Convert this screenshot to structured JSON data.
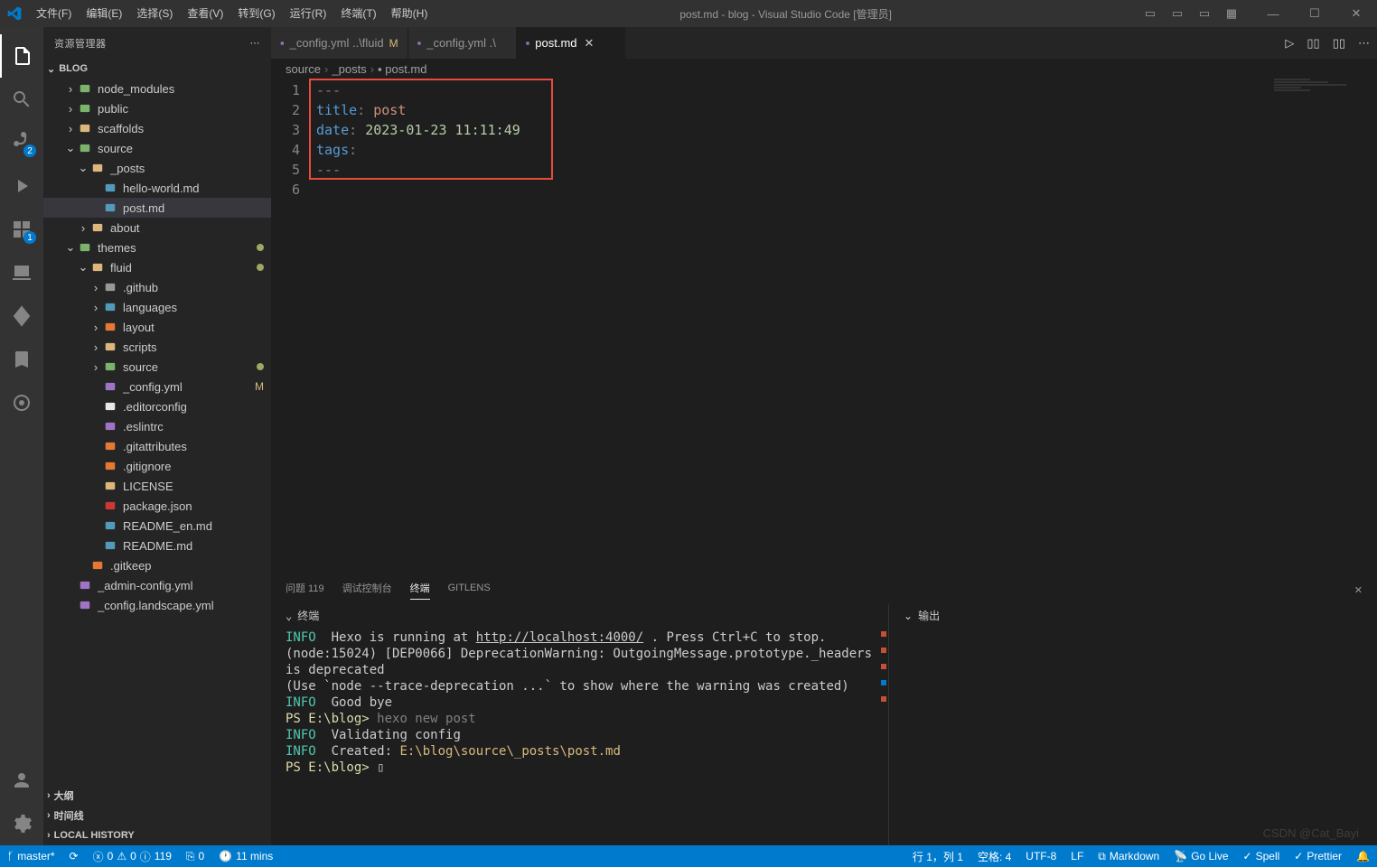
{
  "titlebar": {
    "menus": [
      "文件(F)",
      "编辑(E)",
      "选择(S)",
      "查看(V)",
      "转到(G)",
      "运行(R)",
      "终端(T)",
      "帮助(H)"
    ],
    "title": "post.md - blog - Visual Studio Code [管理员]"
  },
  "sidebar": {
    "title": "资源管理器",
    "section": "BLOG",
    "bottom_sections": [
      "大纲",
      "时间线",
      "LOCAL HISTORY"
    ]
  },
  "tree": [
    {
      "indent": 1,
      "chev": ">",
      "icon": "folder-node",
      "label": "node_modules",
      "color": "#7cb36a"
    },
    {
      "indent": 1,
      "chev": ">",
      "icon": "folder-public",
      "label": "public",
      "color": "#7cb36a"
    },
    {
      "indent": 1,
      "chev": ">",
      "icon": "folder",
      "label": "scaffolds",
      "color": "#dcb67a"
    },
    {
      "indent": 1,
      "chev": "v",
      "icon": "folder-src",
      "label": "source",
      "color": "#7cb36a"
    },
    {
      "indent": 2,
      "chev": "v",
      "icon": "folder-open",
      "label": "_posts",
      "color": "#dcb67a"
    },
    {
      "indent": 3,
      "chev": "",
      "icon": "md",
      "label": "hello-world.md",
      "color": "#519aba"
    },
    {
      "indent": 3,
      "chev": "",
      "icon": "md",
      "label": "post.md",
      "color": "#519aba",
      "selected": true
    },
    {
      "indent": 2,
      "chev": ">",
      "icon": "folder",
      "label": "about",
      "color": "#dcb67a"
    },
    {
      "indent": 1,
      "chev": "v",
      "icon": "folder-theme",
      "label": "themes",
      "color": "#7cb36a",
      "dot": true
    },
    {
      "indent": 2,
      "chev": "v",
      "icon": "folder-open",
      "label": "fluid",
      "color": "#dcb67a",
      "dot": true
    },
    {
      "indent": 3,
      "chev": ">",
      "icon": "folder-git",
      "label": ".github",
      "color": "#999"
    },
    {
      "indent": 3,
      "chev": ">",
      "icon": "folder-lang",
      "label": "languages",
      "color": "#519aba"
    },
    {
      "indent": 3,
      "chev": ">",
      "icon": "folder-layout",
      "label": "layout",
      "color": "#e37933"
    },
    {
      "indent": 3,
      "chev": ">",
      "icon": "folder-script",
      "label": "scripts",
      "color": "#dcb67a"
    },
    {
      "indent": 3,
      "chev": ">",
      "icon": "folder-src",
      "label": "source",
      "color": "#7cb36a",
      "dot": true
    },
    {
      "indent": 3,
      "chev": "",
      "icon": "yml",
      "label": "_config.yml",
      "color": "#a074c4",
      "status": "M"
    },
    {
      "indent": 3,
      "chev": "",
      "icon": "editorconfig",
      "label": ".editorconfig",
      "color": "#e8e8e8"
    },
    {
      "indent": 3,
      "chev": "",
      "icon": "eslint",
      "label": ".eslintrc",
      "color": "#a074c4"
    },
    {
      "indent": 3,
      "chev": "",
      "icon": "git",
      "label": ".gitattributes",
      "color": "#e37933"
    },
    {
      "indent": 3,
      "chev": "",
      "icon": "git",
      "label": ".gitignore",
      "color": "#e37933"
    },
    {
      "indent": 3,
      "chev": "",
      "icon": "license",
      "label": "LICENSE",
      "color": "#dcb67a"
    },
    {
      "indent": 3,
      "chev": "",
      "icon": "npm",
      "label": "package.json",
      "color": "#cb3837"
    },
    {
      "indent": 3,
      "chev": "",
      "icon": "md",
      "label": "README_en.md",
      "color": "#519aba"
    },
    {
      "indent": 3,
      "chev": "",
      "icon": "md",
      "label": "README.md",
      "color": "#519aba"
    },
    {
      "indent": 2,
      "chev": "",
      "icon": "git",
      "label": ".gitkeep",
      "color": "#e37933"
    },
    {
      "indent": 1,
      "chev": "",
      "icon": "yml",
      "label": "_admin-config.yml",
      "color": "#a074c4"
    },
    {
      "indent": 1,
      "chev": "",
      "icon": "yml",
      "label": "_config.landscape.yml",
      "color": "#a074c4"
    }
  ],
  "tabs": [
    {
      "icon": "yml",
      "label": "_config.yml ..\\fluid",
      "status": "M",
      "active": false
    },
    {
      "icon": "yml",
      "label": "_config.yml .\\",
      "status": "",
      "active": false
    },
    {
      "icon": "md",
      "label": "post.md",
      "status": "",
      "active": true
    }
  ],
  "breadcrumb": [
    "source",
    "_posts",
    "post.md"
  ],
  "editor": {
    "lines": [
      {
        "n": 1,
        "tokens": [
          {
            "c": "fm",
            "t": "---"
          }
        ]
      },
      {
        "n": 2,
        "tokens": [
          {
            "c": "key",
            "t": "title"
          },
          {
            "c": "fm",
            "t": ": "
          },
          {
            "c": "val",
            "t": "post"
          }
        ]
      },
      {
        "n": 3,
        "tokens": [
          {
            "c": "key",
            "t": "date"
          },
          {
            "c": "fm",
            "t": ": "
          },
          {
            "c": "str-y",
            "t": "2023-01-23 11:11:49"
          }
        ]
      },
      {
        "n": 4,
        "tokens": [
          {
            "c": "key",
            "t": "tags"
          },
          {
            "c": "fm",
            "t": ":"
          }
        ]
      },
      {
        "n": 5,
        "tokens": [
          {
            "c": "fm",
            "t": "---"
          }
        ]
      },
      {
        "n": 6,
        "tokens": []
      }
    ]
  },
  "panel": {
    "tabs": [
      {
        "label": "问题",
        "badge": "119"
      },
      {
        "label": "调试控制台"
      },
      {
        "label": "终端",
        "active": true
      },
      {
        "label": "GITLENS"
      }
    ],
    "terminal_header": "终端",
    "output_header": "输出"
  },
  "terminal_lines": [
    {
      "parts": [
        {
          "c": "t-info",
          "t": "INFO "
        },
        {
          "c": "",
          "t": " Hexo is running at "
        },
        {
          "c": "t-url",
          "t": "http://localhost:4000/"
        },
        {
          "c": "",
          "t": " . Press Ctrl+C to stop."
        }
      ]
    },
    {
      "parts": [
        {
          "c": "",
          "t": "(node:15024) [DEP0066] DeprecationWarning: OutgoingMessage.prototype._headers is deprecated"
        }
      ]
    },
    {
      "parts": [
        {
          "c": "",
          "t": "(Use `node --trace-deprecation ...` to show where the warning was created)"
        }
      ]
    },
    {
      "parts": [
        {
          "c": "t-info",
          "t": "INFO "
        },
        {
          "c": "",
          "t": " Good bye"
        }
      ]
    },
    {
      "parts": [
        {
          "c": "t-prompt",
          "t": "PS E:\\blog> "
        },
        {
          "c": "t-cmd",
          "t": "hexo new post"
        }
      ]
    },
    {
      "parts": [
        {
          "c": "t-info",
          "t": "INFO "
        },
        {
          "c": "",
          "t": " Validating config"
        }
      ]
    },
    {
      "parts": [
        {
          "c": "t-info",
          "t": "INFO "
        },
        {
          "c": "",
          "t": " Created: "
        },
        {
          "c": "t-path",
          "t": "E:\\blog\\source\\_posts\\post.md"
        }
      ]
    },
    {
      "parts": [
        {
          "c": "t-prompt",
          "t": "PS E:\\blog> "
        },
        {
          "c": "",
          "t": "▯"
        }
      ]
    }
  ],
  "statusbar": {
    "branch": "master*",
    "sync": "⟳",
    "errors": "0",
    "warnings": "0",
    "info": "119",
    "port": "0",
    "clock": "11 mins",
    "lncol": "行 1，列 1",
    "spaces": "空格: 4",
    "encoding": "UTF-8",
    "eol": "LF",
    "lang": "Markdown",
    "golive": "Go Live",
    "spell": "Spell",
    "prettier": "Prettier",
    "notif": "🔔"
  },
  "watermark": "CSDN @Cat_Bayi"
}
